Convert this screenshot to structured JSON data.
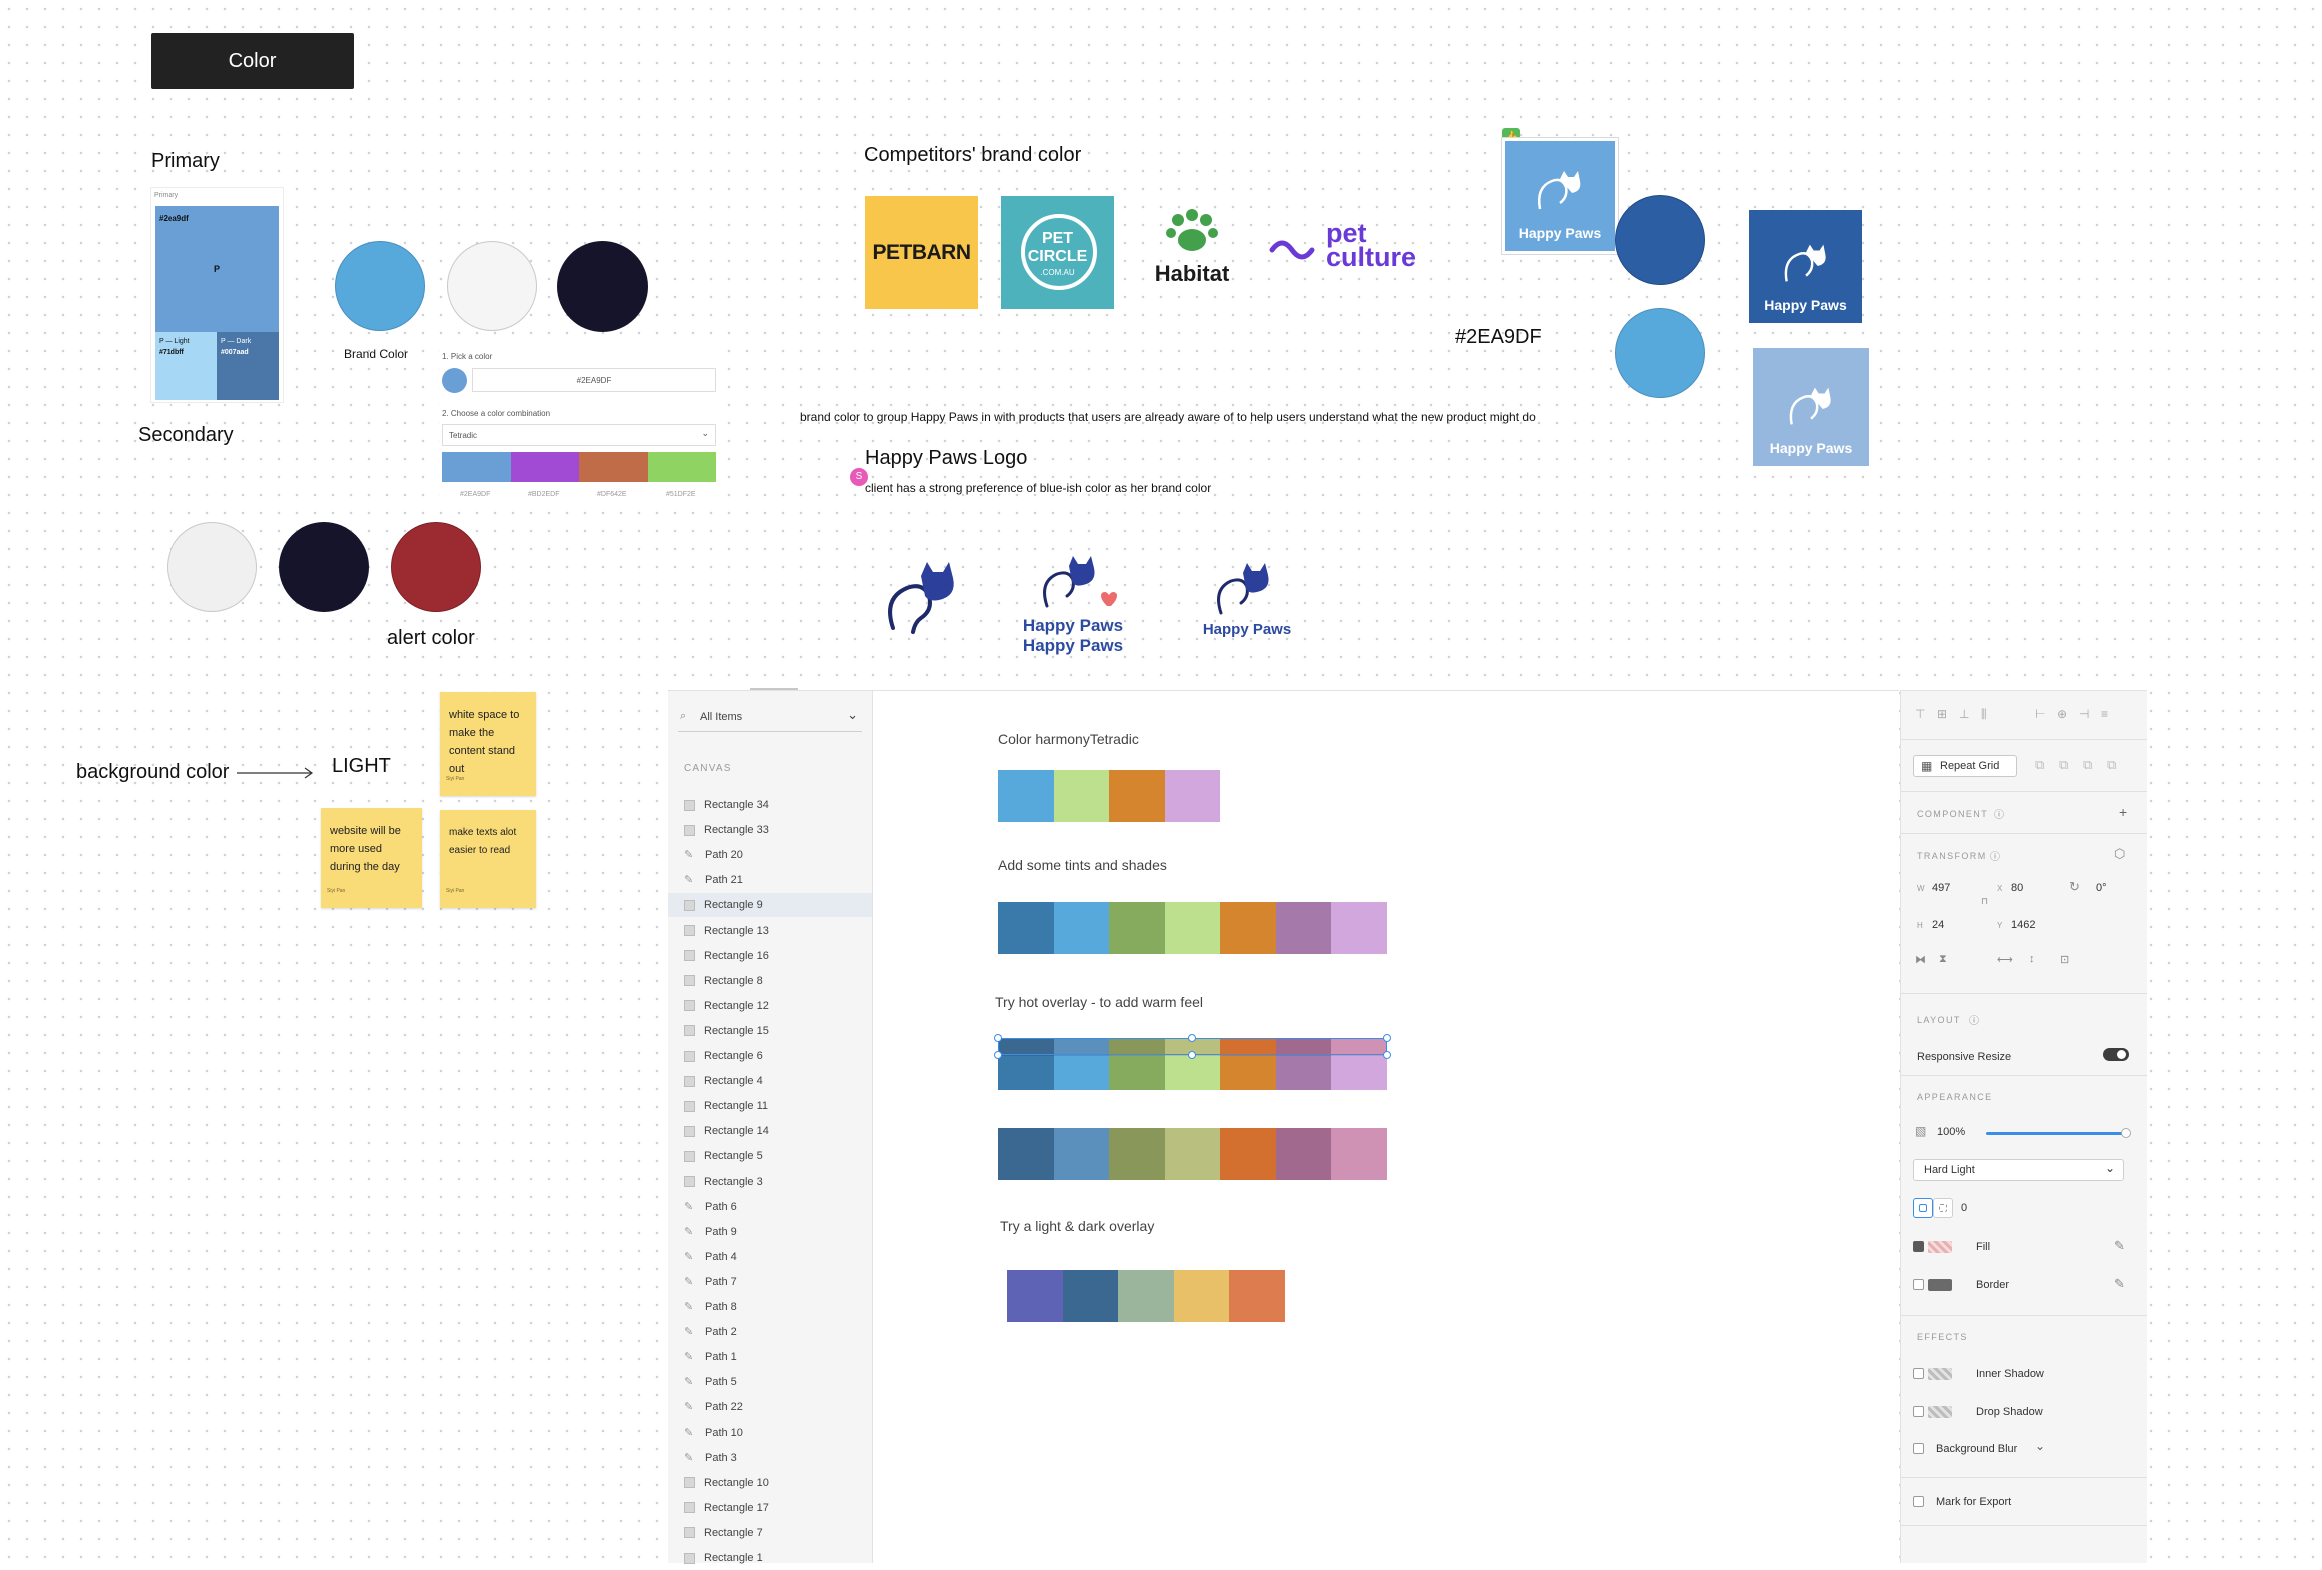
{
  "title_button": "Color",
  "primary": {
    "heading": "Primary",
    "card_label": "Primary",
    "main_hex": "#2ea9df",
    "main_letter": "P",
    "light_label": "P — Light",
    "light_hex": "#71dbff",
    "dark_label": "P — Dark",
    "dark_hex": "#007aad"
  },
  "brand_color_label": "Brand Color",
  "secondary_heading": "Secondary",
  "alert_label": "alert color",
  "picker": {
    "step1": "1. Pick a color",
    "hex_value": "#2EA9DF",
    "step2": "2. Choose a color combination",
    "select_value": "Tetradic",
    "codes": [
      "#2EA9DF",
      "#BD2EDF",
      "#DF642E",
      "#51DF2E"
    ]
  },
  "competitors": {
    "heading": "Competitors' brand color",
    "petbarn": "PETBARN",
    "petcircle_1": "PET",
    "petcircle_2": "CIRCLE",
    "petcircle_3": ".COM.AU",
    "habitat": "Habitat",
    "petculture_1": "pet",
    "petculture_2": "culture"
  },
  "hex_big": "#2EA9DF",
  "brand_note": "brand color to group Happy Paws in with products that users are already aware of to help users understand what the new product might do",
  "logo_section": {
    "heading": "Happy Paws Logo",
    "note": "client has a strong preference of blue-ish color as her brand color",
    "avatar_letter": "S",
    "brand_name": "Happy Paws"
  },
  "logo_cards": {
    "a": "Happy Paws",
    "b": "Happy Paws",
    "c": "Happy Paws"
  },
  "background": {
    "label": "background color",
    "light": "LIGHT"
  },
  "stickies": [
    {
      "text": "white space to make the content stand out",
      "author": "Siyi Pan"
    },
    {
      "text": "website will be more used during the day",
      "author": "Siyi Pan"
    },
    {
      "text": "make texts alot easier to read",
      "author": "Siyi Pan"
    }
  ],
  "layers_panel": {
    "filter_label": "All Items",
    "section": "CANVAS",
    "items": [
      {
        "type": "rect",
        "name": "Rectangle 34"
      },
      {
        "type": "rect",
        "name": "Rectangle 33"
      },
      {
        "type": "path",
        "name": "Path 20"
      },
      {
        "type": "path",
        "name": "Path 21"
      },
      {
        "type": "rect",
        "name": "Rectangle 9"
      },
      {
        "type": "rect",
        "name": "Rectangle 13"
      },
      {
        "type": "rect",
        "name": "Rectangle 16"
      },
      {
        "type": "rect",
        "name": "Rectangle 8"
      },
      {
        "type": "rect",
        "name": "Rectangle 12"
      },
      {
        "type": "rect",
        "name": "Rectangle 15"
      },
      {
        "type": "rect",
        "name": "Rectangle 6"
      },
      {
        "type": "rect",
        "name": "Rectangle 4"
      },
      {
        "type": "rect",
        "name": "Rectangle 11"
      },
      {
        "type": "rect",
        "name": "Rectangle 14"
      },
      {
        "type": "rect",
        "name": "Rectangle 5"
      },
      {
        "type": "rect",
        "name": "Rectangle 3"
      },
      {
        "type": "path",
        "name": "Path 6"
      },
      {
        "type": "path",
        "name": "Path 9"
      },
      {
        "type": "path",
        "name": "Path 4"
      },
      {
        "type": "path",
        "name": "Path 7"
      },
      {
        "type": "path",
        "name": "Path 8"
      },
      {
        "type": "path",
        "name": "Path 2"
      },
      {
        "type": "path",
        "name": "Path 1"
      },
      {
        "type": "path",
        "name": "Path 5"
      },
      {
        "type": "path",
        "name": "Path 22"
      },
      {
        "type": "path",
        "name": "Path 10"
      },
      {
        "type": "path",
        "name": "Path 3"
      },
      {
        "type": "rect",
        "name": "Rectangle 10"
      },
      {
        "type": "rect",
        "name": "Rectangle 17"
      },
      {
        "type": "rect",
        "name": "Rectangle 7"
      },
      {
        "type": "rect",
        "name": "Rectangle 1"
      }
    ],
    "selected_index": 4
  },
  "artboard": {
    "harmony_label": "Color harmonyTetradic",
    "tints_label": "Add some tints and shades",
    "hot_label": "Try hot overlay - to add warm feel",
    "light_dark_label": "Try a light & dark overlay",
    "harmony_colors": [
      "#57a9dc",
      "#bde08f",
      "#d6852f",
      "#d2a7de"
    ],
    "tints_colors": [
      "#3a7aaa",
      "#57a9dc",
      "#86ab5e",
      "#bde08f",
      "#d6852f",
      "#a57aab",
      "#d2a7de"
    ],
    "hot_top_colors": [
      "#3a6891",
      "#5b8fbc",
      "#8a975b",
      "#b9c07f",
      "#d3702f",
      "#a2698f",
      "#cf92b5"
    ],
    "hot_bottom_colors": [
      "#3a7aaa",
      "#57a9dc",
      "#86ab5e",
      "#bde08f",
      "#d6852f",
      "#a57aab",
      "#d2a7de"
    ],
    "hot_row2_colors": [
      "#3a6891",
      "#5b8fbc",
      "#8a975b",
      "#b9c07f",
      "#d3702f",
      "#a2698f",
      "#cf92b5"
    ],
    "light_dark_colors": [
      "#5f63b5",
      "#3a6891",
      "#9bb59d",
      "#e8c068",
      "#dd7c4f"
    ]
  },
  "props_panel": {
    "repeat_grid": "Repeat Grid",
    "component": "COMPONENT",
    "transform": "TRANSFORM",
    "w_label": "W",
    "w_value": "497",
    "x_label": "X",
    "x_value": "80",
    "rotation": "0°",
    "h_label": "H",
    "h_value": "24",
    "y_label": "Y",
    "y_value": "1462",
    "layout": "LAYOUT",
    "responsive_resize": "Responsive Resize",
    "appearance": "APPEARANCE",
    "opacity": "100%",
    "blend_mode": "Hard Light",
    "radius": "0",
    "fill": "Fill",
    "border": "Border",
    "effects": "EFFECTS",
    "inner_shadow": "Inner Shadow",
    "drop_shadow": "Drop Shadow",
    "background_blur": "Background Blur",
    "mark_export": "Mark for Export"
  },
  "colors": {
    "brand_blue": "#57a9dc",
    "navy": "#15142b",
    "alert_red": "#9c2b31",
    "light_grey": "#f0f0f0",
    "sticky_yellow": "#f9db78"
  }
}
